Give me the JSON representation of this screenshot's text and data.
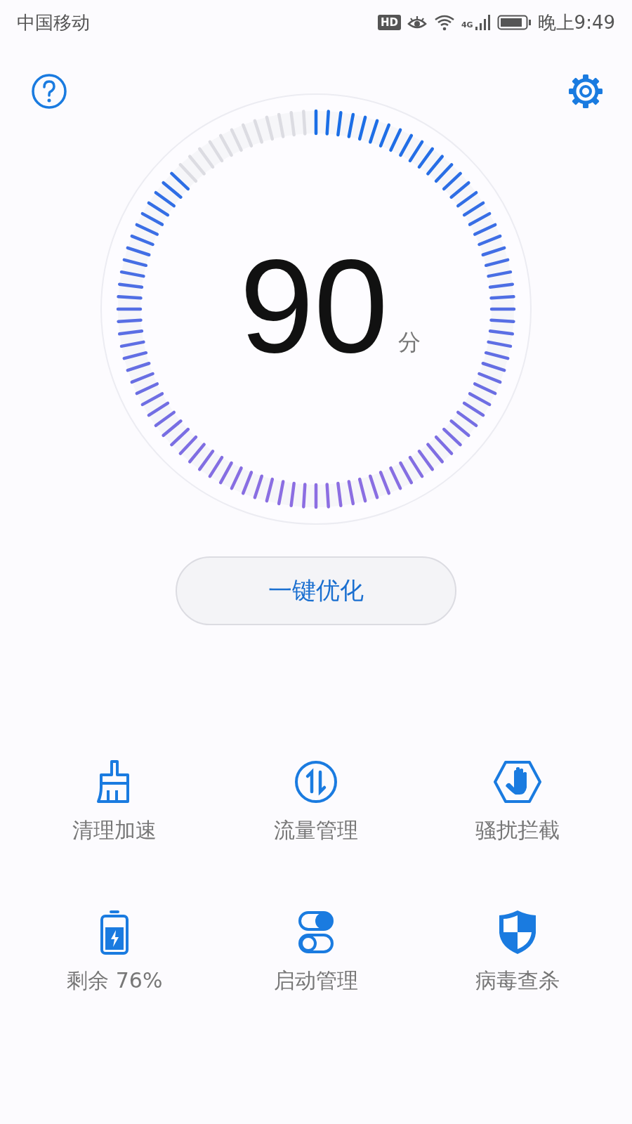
{
  "status_bar": {
    "carrier": "中国移动",
    "badge": "HD",
    "network": "4G",
    "time": "晚上9:49"
  },
  "score": {
    "value": "90",
    "unit": "分"
  },
  "optimize_button": {
    "label": "一键优化"
  },
  "tools": [
    {
      "kind": "broom",
      "label": "清理加速"
    },
    {
      "kind": "data",
      "label": "流量管理"
    },
    {
      "kind": "block",
      "label": "骚扰拦截"
    },
    {
      "kind": "battery",
      "label": "剩余 76%"
    },
    {
      "kind": "startup",
      "label": "启动管理"
    },
    {
      "kind": "shield",
      "label": "病毒查杀"
    }
  ]
}
